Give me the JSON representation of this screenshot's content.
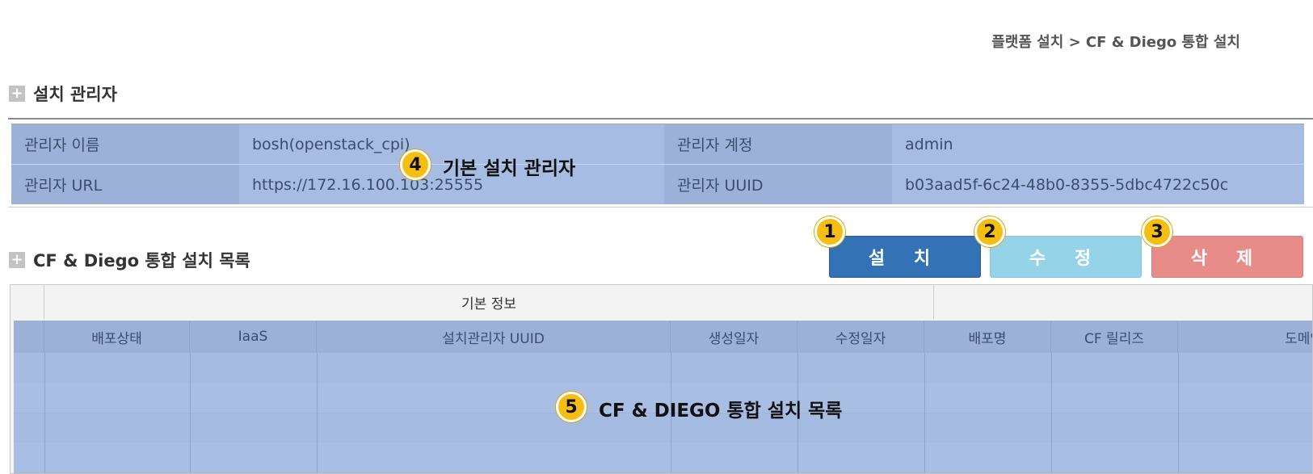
{
  "breadcrumb": "플랫폼 설치 > CF & Diego 통합 설치",
  "section1": {
    "title": "설치 관리자",
    "icon": "+"
  },
  "director": {
    "name_label": "관리자 이름",
    "name_value": "bosh(openstack_cpi)",
    "account_label": "관리자 계정",
    "account_value": "admin",
    "url_label": "관리자 URL",
    "url_value": "https://172.16.100.103:25555",
    "uuid_label": "관리자 UUID",
    "uuid_value": "b03aad5f-6c24-48b0-8355-5dbc4722c50c"
  },
  "section2": {
    "title": "CF & Diego 통합 설치 목록",
    "icon": "+"
  },
  "buttons": {
    "install": "설 치",
    "edit": "수 정",
    "delete": "삭 제"
  },
  "annotations": {
    "a1": "1",
    "a2": "2",
    "a3": "3",
    "a4": "4",
    "a4_text": "기본 설치 관리자",
    "a5": "5",
    "a5_text": "CF & DIEGO 통합 설치 목록"
  },
  "grid": {
    "group_basic": "기본 정보",
    "columns": [
      "배포상태",
      "IaaS",
      "설치관리자 UUID",
      "생성일자",
      "수정일자",
      "배포명",
      "CF 릴리즈",
      "도메인"
    ]
  },
  "colors": {
    "install": "#3372b4",
    "edit": "#95d3e8",
    "delete": "#e88c8a",
    "badge": "#f6bd12",
    "overlay": "#9bb1d8"
  }
}
